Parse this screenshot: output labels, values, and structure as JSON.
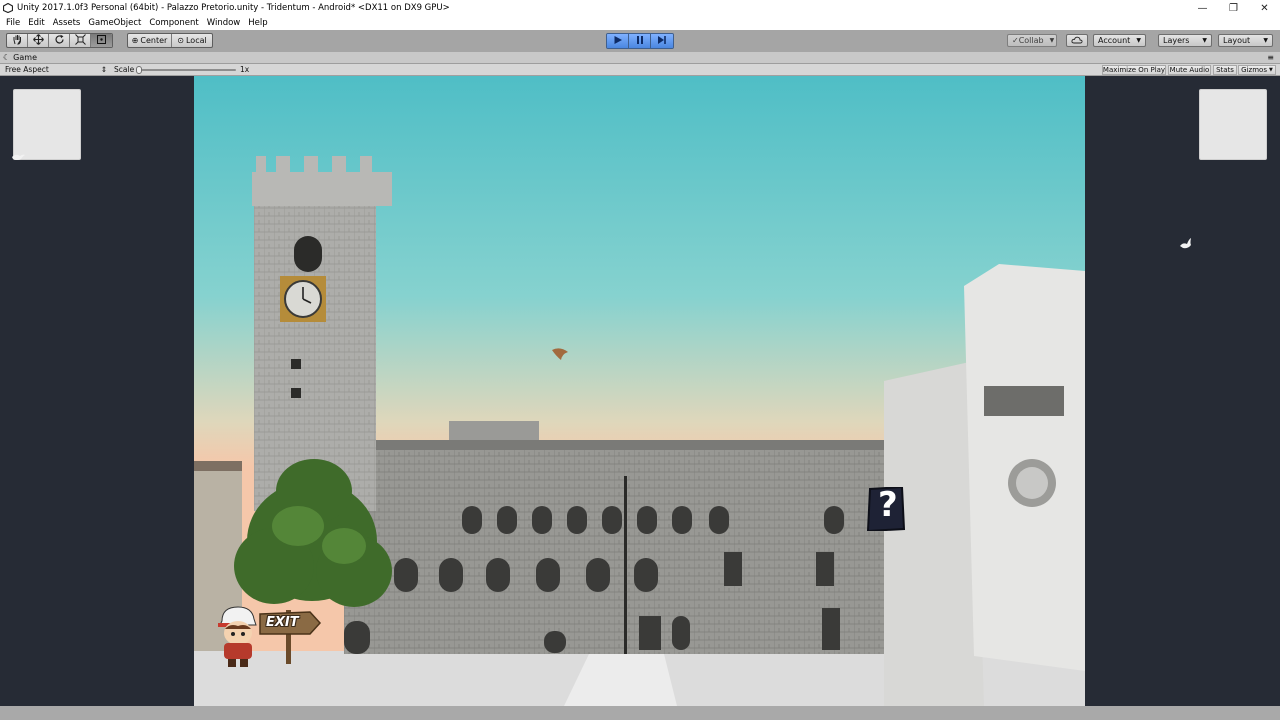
{
  "window": {
    "title": "Unity 2017.1.0f3 Personal (64bit) - Palazzo Pretorio.unity - Tridentum - Android* <DX11 on DX9 GPU>",
    "controls": {
      "minimize": "—",
      "restore": "❐",
      "close": "✕"
    }
  },
  "menu": {
    "items": [
      "File",
      "Edit",
      "Assets",
      "GameObject",
      "Component",
      "Window",
      "Help"
    ]
  },
  "toolbar": {
    "transform_tools": [
      "hand-icon",
      "move-icon",
      "rotate-icon",
      "scale-icon",
      "rect-icon"
    ],
    "pivot_center": "Center",
    "pivot_local": "Local",
    "play_state": {
      "playing": true,
      "paused": true
    },
    "collab": "Collab",
    "account": "Account",
    "layers": "Layers",
    "layout": "Layout"
  },
  "game_view": {
    "tab_label": "Game",
    "aspect": "Free Aspect",
    "scale_label": "Scale",
    "scale_value": "1x",
    "buttons": {
      "maximize_on_play": "Maximize On Play",
      "mute_audio": "Mute Audio",
      "stats": "Stats",
      "gizmos": "Gizmos"
    }
  },
  "scene": {
    "exit_sign": "EXIT",
    "hint_marker": "?"
  },
  "colors": {
    "toolbar_bg": "#a5a5a5",
    "play_active": "#4a86e0",
    "game_backdrop": "#262b35",
    "sky_top": "#4fbec6",
    "sky_bottom": "#f5c7aa"
  }
}
